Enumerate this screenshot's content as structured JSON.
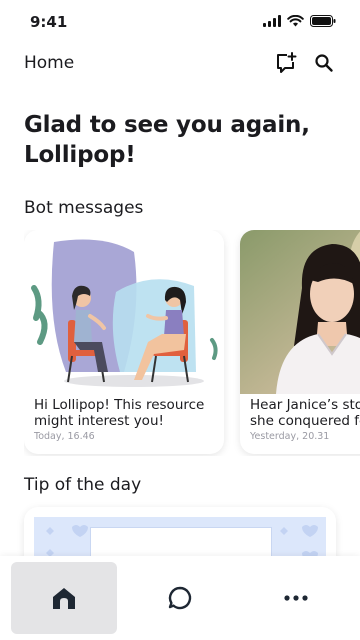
{
  "status_bar": {
    "time": "9:41"
  },
  "header": {
    "title": "Home"
  },
  "greeting": "Glad to see you again, Lollipop!",
  "bot_messages": {
    "title": "Bot messages",
    "cards": [
      {
        "title": "Hi Lollipop! This resource might interest you!",
        "time": "Today, 16.46"
      },
      {
        "title": "Hear Janice’s story on how she conquered fear",
        "time": "Yesterday, 20.31"
      }
    ]
  },
  "tip": {
    "title": "Tip of the day"
  },
  "icons": {
    "add_chat": "add-chat-icon",
    "search": "search-icon",
    "home": "home-icon",
    "chat": "chat-bubble-icon",
    "more": "more-dots-icon"
  },
  "colors": {
    "nav_selected_bg": "#e4e4e6",
    "text": "#1b1b1f",
    "muted": "#9a9aa3"
  }
}
